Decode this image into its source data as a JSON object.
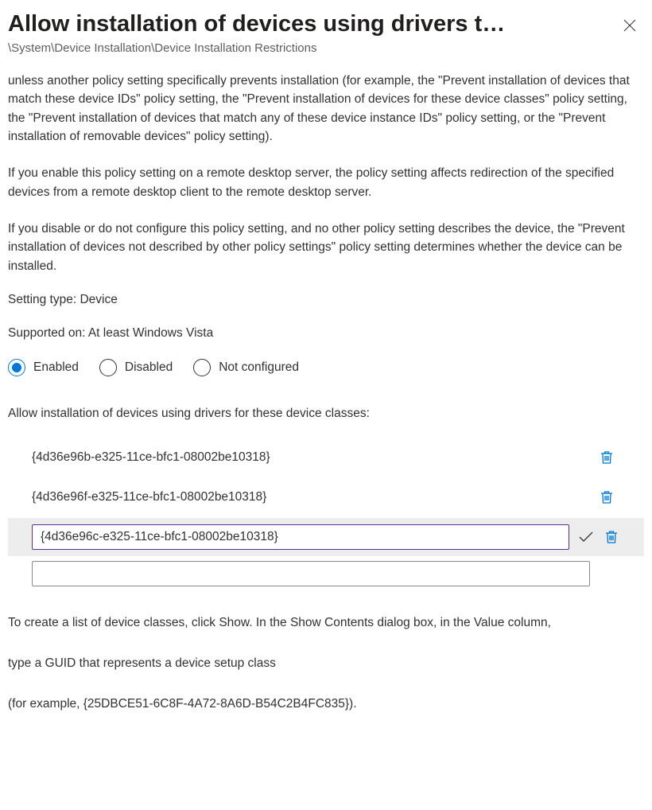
{
  "header": {
    "title": "Allow installation of devices using drivers t…",
    "breadcrumb": "\\System\\Device Installation\\Device Installation Restrictions"
  },
  "description": "unless another policy setting specifically prevents installation (for example, the \"Prevent installation of devices that match these device IDs\" policy setting, the \"Prevent installation of devices for these device classes\" policy setting, the \"Prevent installation of devices that match any of these device instance IDs\" policy setting, or the \"Prevent installation of removable devices\" policy setting).\n\nIf you enable this policy setting on a remote desktop server, the policy setting affects redirection of the specified devices from a remote desktop client to the remote desktop server.\n\nIf you disable or do not configure this policy setting, and no other policy setting describes the device, the \"Prevent installation of devices not described by other policy settings\" policy setting determines whether the device can be installed.",
  "settingTypeLabel": "Setting type: ",
  "settingTypeValue": "Device",
  "supportedOnLabel": "Supported on: ",
  "supportedOnValue": "At least Windows Vista",
  "state": {
    "options": {
      "enabled": "Enabled",
      "disabled": "Disabled",
      "notConfigured": "Not configured"
    },
    "selected": "enabled"
  },
  "list": {
    "label": "Allow installation of devices using drivers for these device classes:",
    "items": [
      "{4d36e96b-e325-11ce-bfc1-08002be10318}",
      "{4d36e96f-e325-11ce-bfc1-08002be10318}"
    ],
    "editingValue": "{4d36e96c-e325-11ce-bfc1-08002be10318}",
    "newValue": ""
  },
  "footer": {
    "line1": "To create a list of device classes, click Show. In the Show Contents dialog box, in the Value column,",
    "line2": "type a GUID that represents a device setup class",
    "line3": "(for example, {25DBCE51-6C8F-4A72-8A6D-B54C2B4FC835})."
  }
}
